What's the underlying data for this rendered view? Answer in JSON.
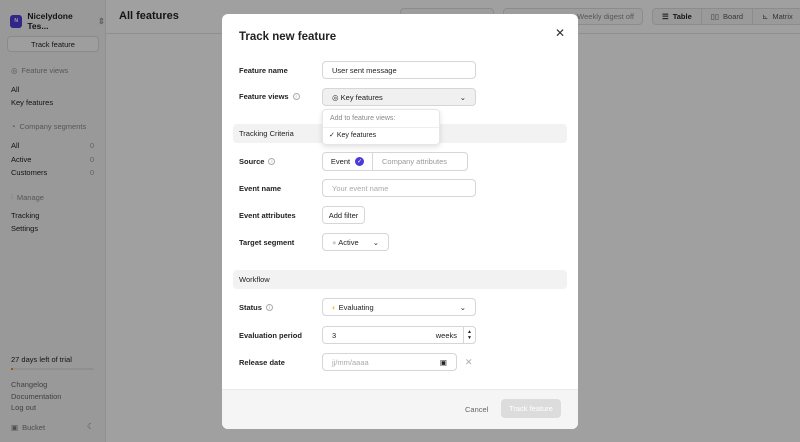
{
  "sidebar": {
    "workspace": "Nicelydone Tes...",
    "workspace_initial": "N",
    "track_button": "Track feature",
    "feature_views_heading": "Feature views",
    "feature_views": [
      "All",
      "Key features"
    ],
    "segments_heading": "Company segments",
    "segments": [
      {
        "label": "All",
        "count": "0"
      },
      {
        "label": "Active",
        "count": "0"
      },
      {
        "label": "Customers",
        "count": "0"
      }
    ],
    "manage_heading": "Manage",
    "manage": [
      "Tracking",
      "Settings"
    ],
    "trial": "27 days left of trial",
    "trial_progress": 0.03,
    "links": [
      "Changelog",
      "Documentation",
      "Log out"
    ],
    "brand": "Bucket"
  },
  "header": {
    "title": "All features",
    "digest": "Weekly digest off",
    "views": [
      "Table",
      "Board",
      "Matrix"
    ]
  },
  "modal": {
    "title": "Track new feature",
    "feature_name_label": "Feature name",
    "feature_name_value": "User sent message",
    "feature_views_label": "Feature views",
    "feature_views_value": "Key features",
    "dropdown_heading": "Add to feature views:",
    "dropdown_item": "Key features",
    "tracking_section": "Tracking Criteria",
    "source_label": "Source",
    "source_options": [
      "Event",
      "Company attributes"
    ],
    "event_name_label": "Event name",
    "event_name_placeholder": "Your event name",
    "event_attr_label": "Event attributes",
    "add_filter": "Add filter",
    "target_label": "Target segment",
    "target_value": "Active",
    "workflow_section": "Workflow",
    "status_label": "Status",
    "status_value": "Evaluating",
    "eval_label": "Evaluation period",
    "eval_value": "3",
    "eval_unit": "weeks",
    "release_label": "Release date",
    "release_placeholder": "jj/mm/aaaa",
    "cancel": "Cancel",
    "submit": "Track feature"
  },
  "colors": {
    "accent": "#4b3ad6",
    "status": "#f2c230"
  }
}
